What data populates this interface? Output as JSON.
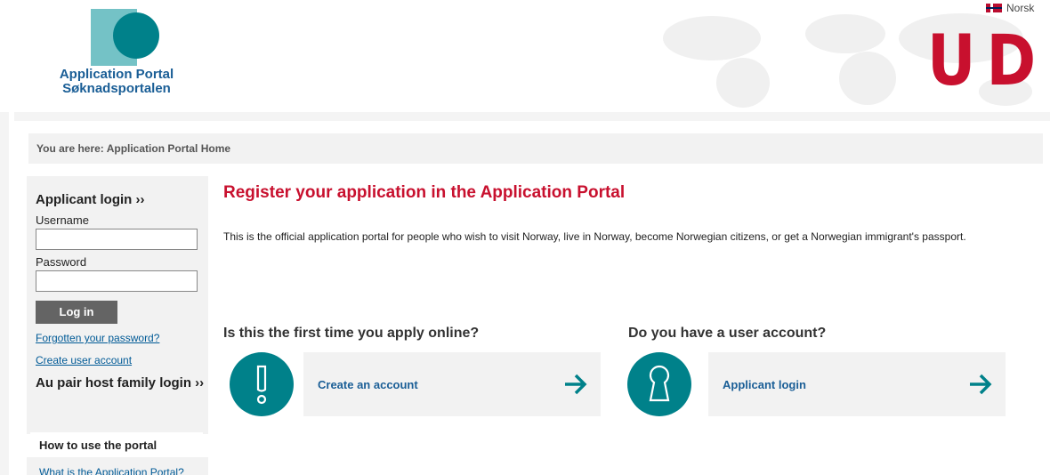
{
  "header": {
    "logo_line1": "Application Portal",
    "logo_line2": "Søknadsportalen",
    "language": "Norsk",
    "brand": "UDI"
  },
  "breadcrumb": "You are here: Application Portal Home",
  "sidebar": {
    "applicant_login": "Applicant login ››",
    "username_label": "Username",
    "username_value": "",
    "password_label": "Password",
    "password_value": "",
    "login_button": "Log in",
    "forgot_link": "Forgotten your password?",
    "create_link": "Create user account",
    "au_pair_login": "Au pair host family login ››",
    "how_to": "How to use the portal",
    "what_is": "What is the Application Portal?"
  },
  "main": {
    "title": "Register your application in the Application Portal",
    "intro": "This is the official application portal for people who wish to visit Norway, live in Norway, become Norwegian citizens, or get a Norwegian immigrant's passport.",
    "first_time_heading": "Is this the first time you apply online?",
    "create_account": "Create an account",
    "have_account_heading": "Do you have a user account?",
    "applicant_login": "Applicant login"
  },
  "colors": {
    "accent_red": "#c8102e",
    "teal": "#00818a",
    "link_blue": "#005a96"
  },
  "icons": {
    "first_time": "exclamation-icon",
    "login": "keyhole-icon",
    "arrow": "arrow-right-icon"
  }
}
